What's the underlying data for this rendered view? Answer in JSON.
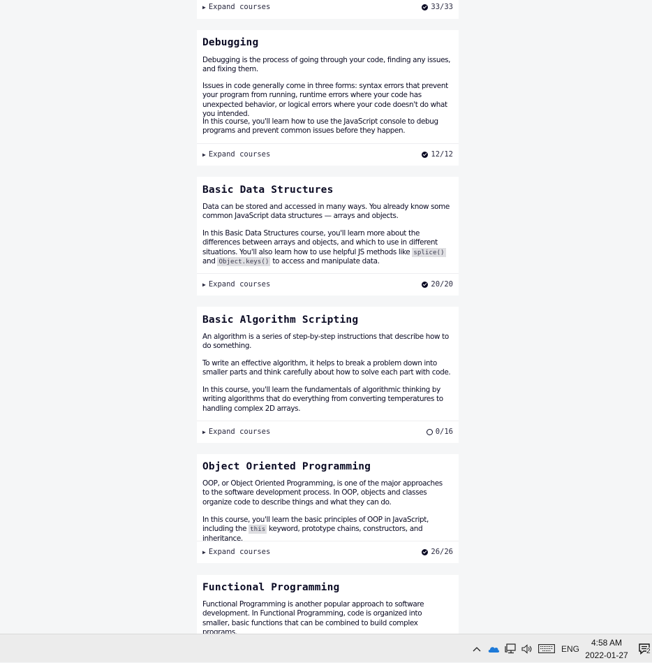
{
  "cards": [
    {
      "title": "",
      "paragraphs": [],
      "expand_label": "Expand courses",
      "progress": "33/33",
      "status": "complete"
    },
    {
      "title": "Debugging",
      "paragraphs": [
        [
          "Debugging is the process of going through your code, finding any issues, and fixing them."
        ],
        [
          "Issues in code generally come in three forms: syntax errors that prevent your program from running, runtime errors where your code has unexpected behavior, or logical errors where your code doesn't do what you intended."
        ],
        [
          "In this course, you'll learn how to use the JavaScript console to debug programs and prevent common issues before they happen."
        ]
      ],
      "expand_label": "Expand courses",
      "progress": "12/12",
      "status": "complete"
    },
    {
      "title": "Basic Data Structures",
      "paragraphs": [
        [
          "Data can be stored and accessed in many ways. You already know some common JavaScript data structures — arrays and objects."
        ],
        [
          "In this Basic Data Structures course, you'll learn more about the differences between arrays and objects, and which to use in different situations. You'll also learn how to use helpful JS methods like ",
          "splice()",
          " and ",
          "Object.keys()",
          " to access and manipulate data."
        ]
      ],
      "expand_label": "Expand courses",
      "progress": "20/20",
      "status": "complete"
    },
    {
      "title": "Basic Algorithm Scripting",
      "paragraphs": [
        [
          "An algorithm is a series of step-by-step instructions that describe how to do something."
        ],
        [
          "To write an effective algorithm, it helps to break a problem down into smaller parts and think carefully about how to solve each part with code."
        ],
        [
          "In this course, you'll learn the fundamentals of algorithmic thinking by writing algorithms that do everything from converting temperatures to handling complex 2D arrays."
        ]
      ],
      "expand_label": "Expand courses",
      "progress": "0/16",
      "status": "incomplete"
    },
    {
      "title": "Object Oriented Programming",
      "paragraphs": [
        [
          "OOP, or Object Oriented Programming, is one of the major approaches to the software development process. In OOP, objects and classes organize code to describe things and what they can do."
        ],
        [
          "In this course, you'll learn the basic principles of OOP in JavaScript, including the ",
          "this",
          " keyword, prototype chains, constructors, and inheritance."
        ]
      ],
      "expand_label": "Expand courses",
      "progress": "26/26",
      "status": "complete"
    },
    {
      "title": "Functional Programming",
      "paragraphs": [
        [
          "Functional Programming is another popular approach to software development. In Functional Programming, code is organized into smaller, basic functions that can be combined to build complex programs."
        ]
      ],
      "expand_label": "",
      "progress": "",
      "status": ""
    }
  ],
  "taskbar": {
    "language": "ENG",
    "time": "4:58 AM",
    "date": "2022-01-27",
    "notification_count": "2",
    "icons": [
      "chevron-up-icon",
      "onedrive-cloud-icon",
      "network-icon",
      "volume-icon",
      "keyboard-icon",
      "notification-icon"
    ]
  }
}
